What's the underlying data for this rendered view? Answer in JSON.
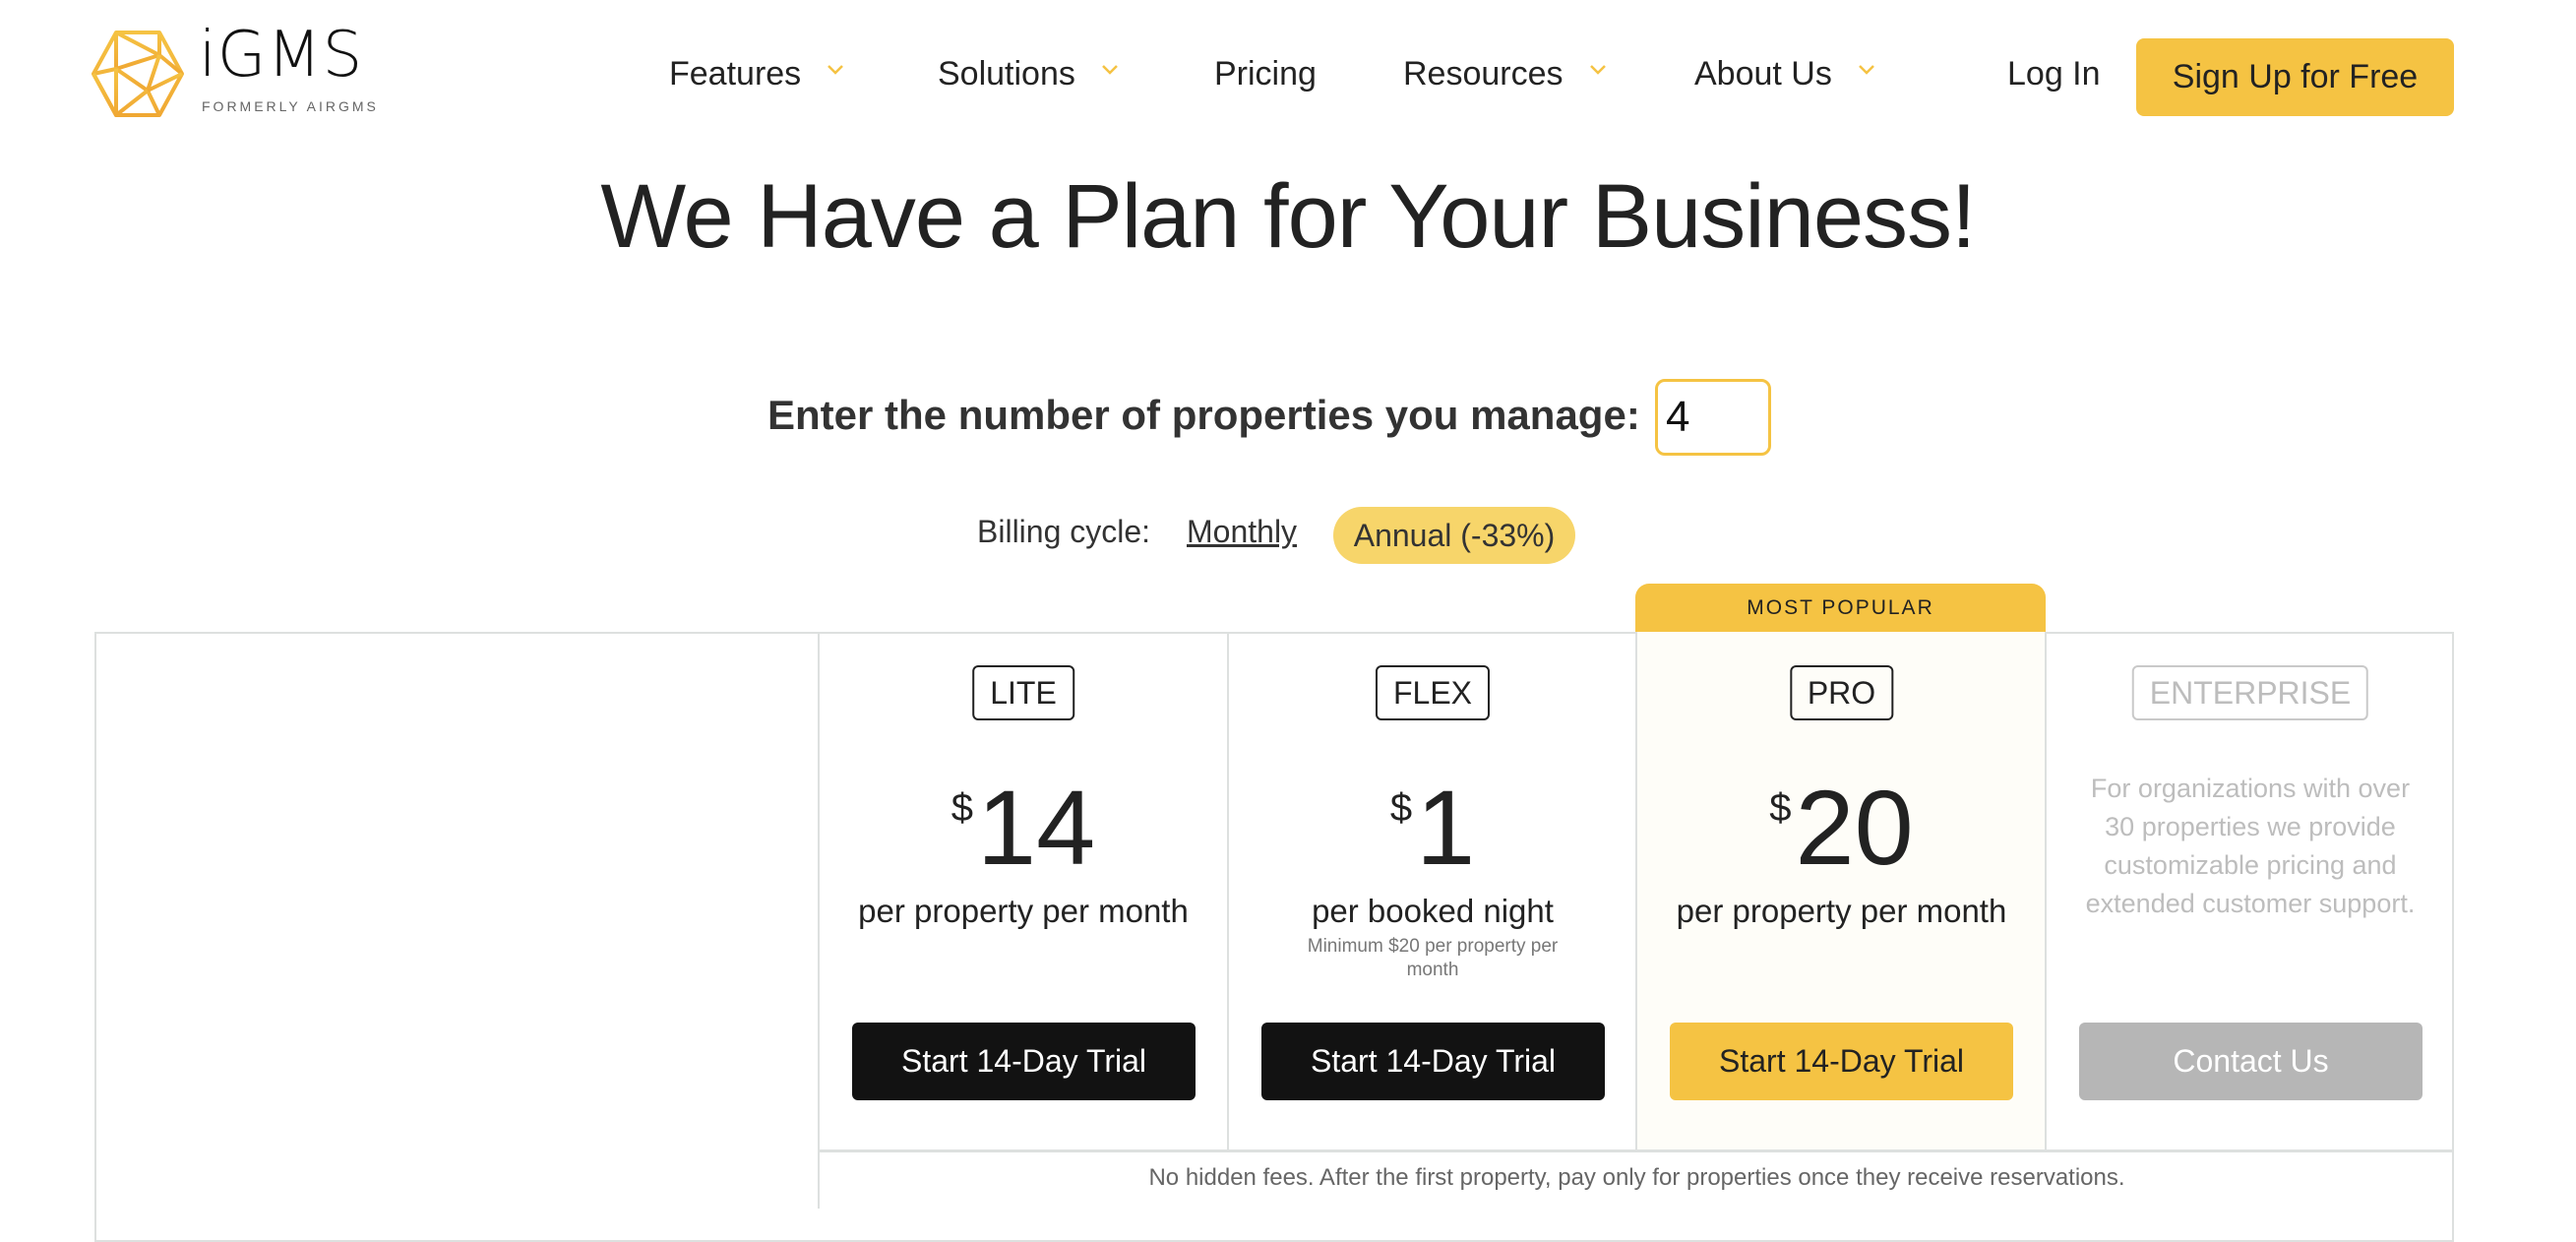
{
  "brand": {
    "name": "iGMS",
    "tagline": "FORMERLY AIRGMS",
    "accent": "#F5C343"
  },
  "nav": {
    "items": [
      {
        "label": "Features",
        "has_dropdown": true
      },
      {
        "label": "Solutions",
        "has_dropdown": true
      },
      {
        "label": "Pricing",
        "has_dropdown": false
      },
      {
        "label": "Resources",
        "has_dropdown": true
      },
      {
        "label": "About Us",
        "has_dropdown": true
      }
    ],
    "login_label": "Log In",
    "signup_label": "Sign Up for Free"
  },
  "page": {
    "title": "We Have a Plan for Your Business!"
  },
  "properties": {
    "label": "Enter the number of properties you manage:",
    "value": "4"
  },
  "billing": {
    "label": "Billing cycle:",
    "options": [
      "Monthly",
      "Annual (-33%)"
    ],
    "selected": "Annual (-33%)"
  },
  "plans": {
    "popular_label": "MOST POPULAR",
    "lite": {
      "name": "LITE",
      "currency": "$",
      "price": "14",
      "unit": "per property per month",
      "cta": "Start 14-Day Trial"
    },
    "flex": {
      "name": "FLEX",
      "currency": "$",
      "price": "1",
      "unit": "per booked night",
      "note": "Minimum $20 per property per month",
      "cta": "Start 14-Day Trial"
    },
    "pro": {
      "name": "PRO",
      "currency": "$",
      "price": "20",
      "unit": "per property per month",
      "cta": "Start 14-Day Trial"
    },
    "enterprise": {
      "name": "ENTERPRISE",
      "description": "For organizations with over 30 properties we provide customizable pricing and extended customer support.",
      "cta": "Contact Us"
    }
  },
  "footer_note": "No hidden fees. After the first property, pay only for properties once they receive reservations."
}
